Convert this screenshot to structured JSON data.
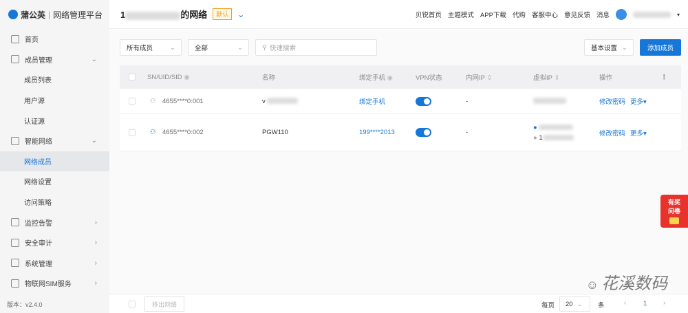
{
  "brand": {
    "name": "蒲公英",
    "platform": "网络管理平台"
  },
  "sidebar": {
    "items": [
      {
        "label": "首页",
        "icon": "home-icon"
      },
      {
        "label": "成员管理",
        "icon": "user-icon",
        "arrow": "⌄"
      },
      {
        "label": "成员列表",
        "sub": true
      },
      {
        "label": "用户源",
        "sub": true
      },
      {
        "label": "认证源",
        "sub": true
      },
      {
        "label": "智能网络",
        "icon": "network-icon",
        "arrow": "⌄"
      },
      {
        "label": "网络成员",
        "sub": true,
        "active": true
      },
      {
        "label": "网络设置",
        "sub": true
      },
      {
        "label": "访问策略",
        "sub": true
      },
      {
        "label": "监控告警",
        "icon": "monitor-icon",
        "arrow": "›"
      },
      {
        "label": "安全审计",
        "icon": "audit-icon",
        "arrow": "›"
      },
      {
        "label": "系统管理",
        "icon": "settings-icon",
        "arrow": "›"
      },
      {
        "label": "物联网SIM服务",
        "icon": "sim-icon",
        "arrow": "›"
      }
    ],
    "version": "版本：v2.4.0"
  },
  "header": {
    "title_prefix": "1",
    "title_suffix": "的网络",
    "badge": "默认",
    "links": [
      "贝锐首页",
      "主题模式",
      "APP下载",
      "代购",
      "客服中心",
      "意见反馈",
      "消息"
    ]
  },
  "toolbar": {
    "member_filter": "所有成员",
    "status_filter": "全部",
    "search_placeholder": "快速搜索",
    "basic_settings": "基本设置",
    "add_member": "添加成员"
  },
  "table": {
    "columns": [
      "SN/UID/SID",
      "名称",
      "绑定手机",
      "VPN状态",
      "内网IP",
      "虚拟IP",
      "操作"
    ],
    "rows": [
      {
        "id": "4655****0:001",
        "name": "v",
        "phone": "绑定手机",
        "vpn": true,
        "lan_ip": "-",
        "action": "修改密码",
        "more": "更多▾",
        "user_color": "#aaa"
      },
      {
        "id": "4655****0:002",
        "name": "PGW110",
        "phone": "199****2013",
        "vpn": true,
        "lan_ip": "-",
        "vip2_prefix": "1",
        "action": "修改密码",
        "more": "更多▾",
        "user_color": "#1677d9"
      }
    ]
  },
  "footer": {
    "remove": "移出网络",
    "per_page_label": "每页",
    "per_page": "20",
    "unit": "条",
    "page": "1"
  },
  "promo": {
    "line1": "有奖",
    "line2": "问卷"
  },
  "watermark": "花溪数码"
}
